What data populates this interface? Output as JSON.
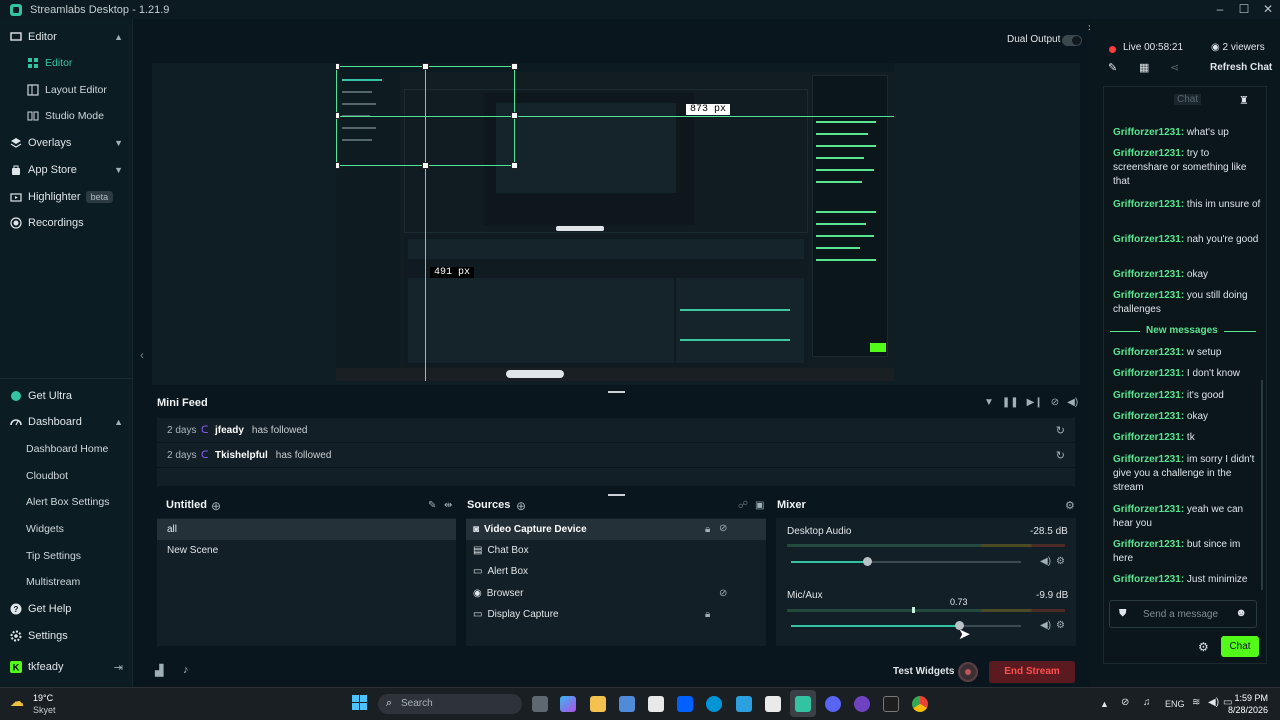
{
  "window": {
    "title": "Streamlabs Desktop - 1.21.9"
  },
  "sidebar": {
    "items": [
      {
        "label": "Editor"
      },
      {
        "label": "Editor"
      },
      {
        "label": "Layout Editor"
      },
      {
        "label": "Studio Mode"
      },
      {
        "label": "Overlays"
      },
      {
        "label": "App Store"
      },
      {
        "label": "Highlighter",
        "badge": "beta"
      },
      {
        "label": "Recordings"
      }
    ],
    "bottom": [
      {
        "label": "Get Ultra"
      },
      {
        "label": "Dashboard"
      },
      {
        "label": "Dashboard Home"
      },
      {
        "label": "Cloudbot"
      },
      {
        "label": "Alert Box Settings"
      },
      {
        "label": "Widgets"
      },
      {
        "label": "Tip Settings"
      },
      {
        "label": "Multistream"
      },
      {
        "label": "Get Help"
      },
      {
        "label": "Settings"
      },
      {
        "label": "tkfeady"
      }
    ]
  },
  "toolbar": {
    "dual_output": "Dual Output"
  },
  "preview": {
    "measure_top": "873 px",
    "measure_mid": "491 px"
  },
  "mini_feed": {
    "title": "Mini Feed",
    "rows": [
      {
        "when": "2 days",
        "who": "jfeady",
        "what": "has followed"
      },
      {
        "when": "2 days",
        "who": "Tkishelpful",
        "what": "has followed"
      }
    ]
  },
  "scenes": {
    "title": "Untitled",
    "items": [
      "all",
      "New Scene"
    ]
  },
  "sources": {
    "title": "Sources",
    "items": [
      "Video Capture Device",
      "Chat Box",
      "Alert Box",
      "Browser",
      "Display Capture"
    ]
  },
  "mixer": {
    "title": "Mixer",
    "channels": [
      {
        "name": "Desktop Audio",
        "db": "-28.5 dB",
        "level": 0.33
      },
      {
        "name": "Mic/Aux",
        "db": "-9.9 dB",
        "level": 0.73,
        "tooltip": "0.73"
      }
    ]
  },
  "footer": {
    "test_widgets": "Test Widgets",
    "end_stream": "End Stream"
  },
  "chat": {
    "live": "Live 00:58:21",
    "viewers": "2 viewers",
    "refresh": "Refresh Chat",
    "tab": "Chat",
    "new_messages": "New messages",
    "messages": [
      {
        "user": "Grifforzer1231",
        "text": "what's up"
      },
      {
        "user": "Grifforzer1231",
        "text": "try to screenshare or something like that"
      },
      {
        "user": "Grifforzer1231",
        "text": "this im unsure of"
      },
      {
        "user": "Grifforzer1231",
        "text": "nah you're good"
      },
      {
        "user": "Grifforzer1231",
        "text": "okay"
      },
      {
        "user": "Grifforzer1231",
        "text": "you still doing challenges"
      },
      {
        "user": "Grifforzer1231",
        "text": "w setup"
      },
      {
        "user": "Grifforzer1231",
        "text": "I don't know"
      },
      {
        "user": "Grifforzer1231",
        "text": "it's good"
      },
      {
        "user": "Grifforzer1231",
        "text": "okay"
      },
      {
        "user": "Grifforzer1231",
        "text": "tk"
      },
      {
        "user": "Grifforzer1231",
        "text": "im sorry I didn't give you a challenge in the stream"
      },
      {
        "user": "Grifforzer1231",
        "text": "yeah we can hear you"
      },
      {
        "user": "Grifforzer1231",
        "text": "but since im here"
      },
      {
        "user": "Grifforzer1231",
        "text": "Just minimize"
      }
    ],
    "input_placeholder": "Send a message",
    "send_label": "Chat"
  },
  "taskbar": {
    "weather_temp": "19°C",
    "weather_place": "Skyet",
    "search_placeholder": "Search",
    "lang": "ENG",
    "time": "1:59 PM",
    "date": "8/28/2026"
  },
  "colors": {
    "accent": "#31c3a2",
    "chat_user": "#57e58f",
    "danger": "#ff4f4f"
  }
}
